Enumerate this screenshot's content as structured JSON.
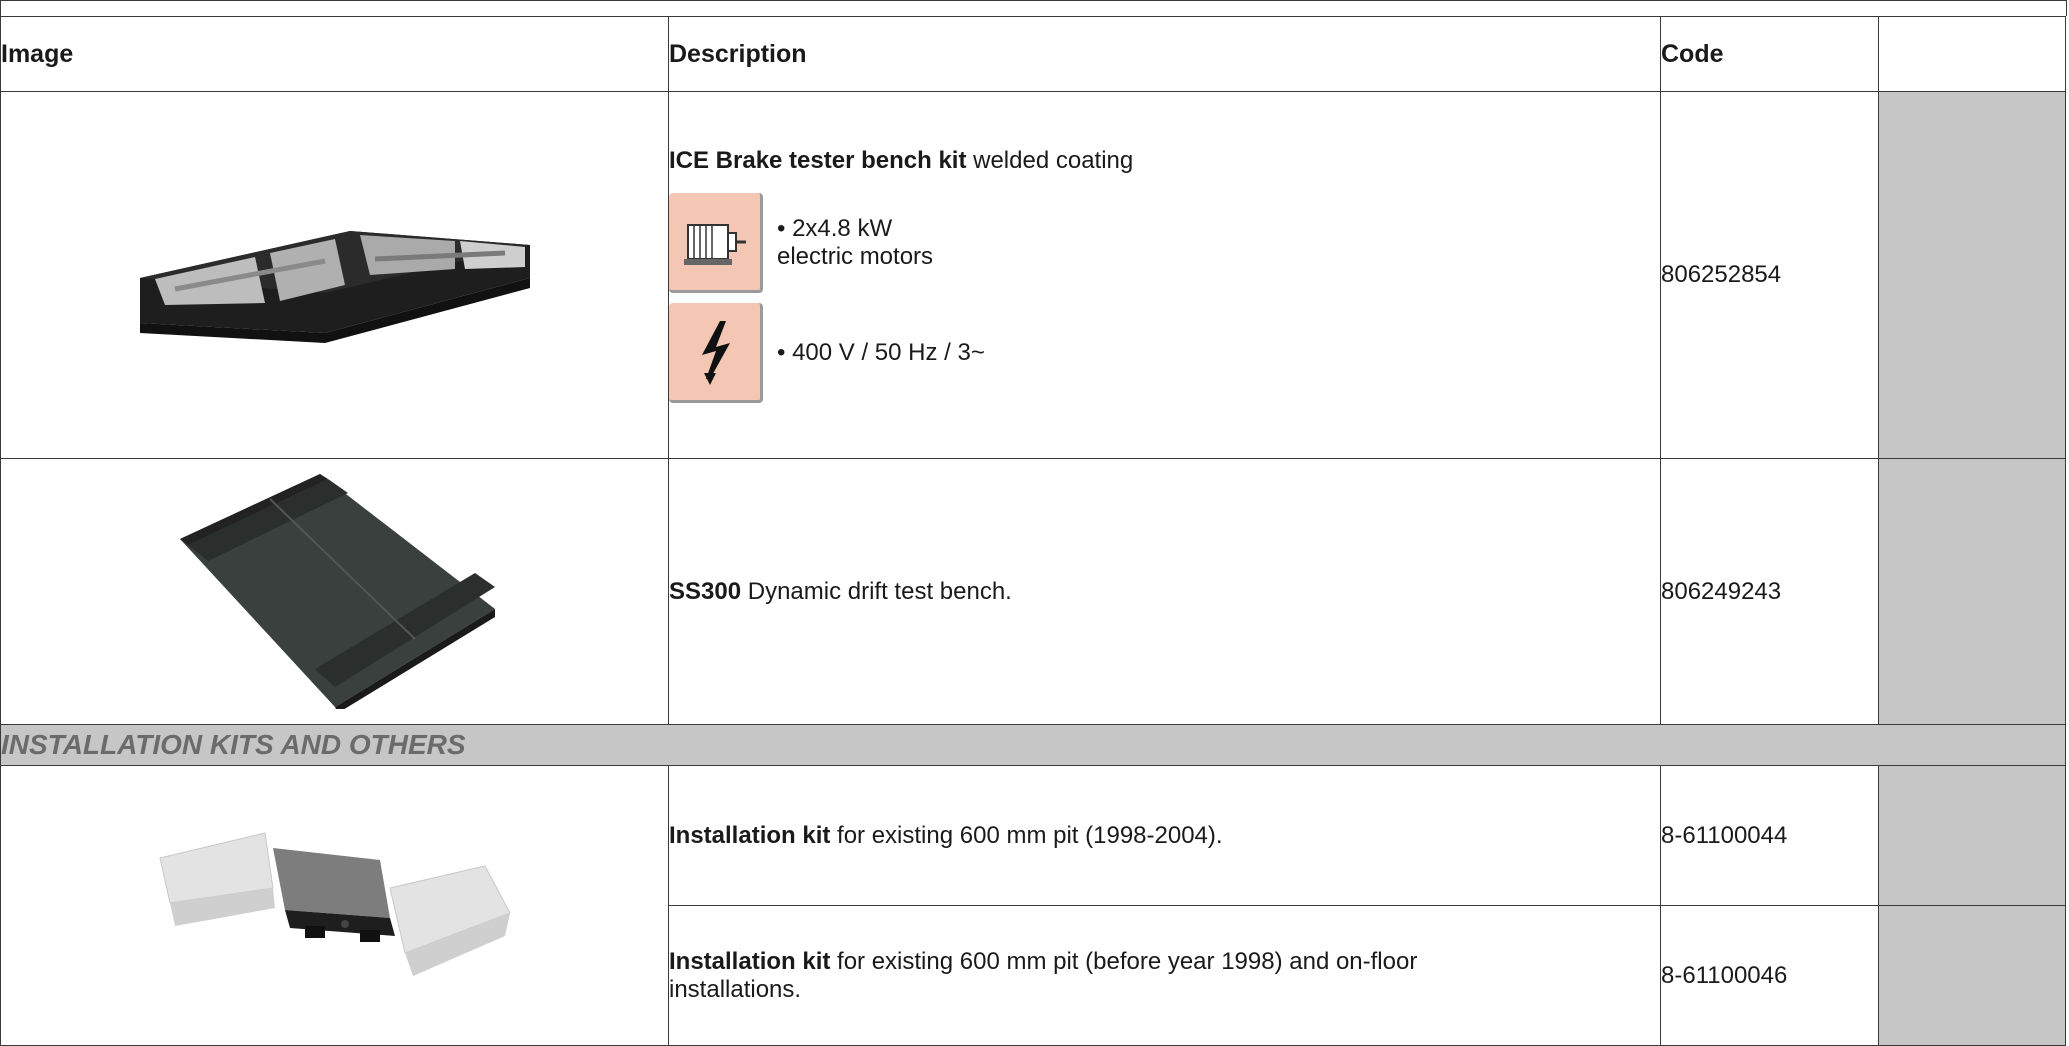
{
  "table": {
    "headers": {
      "image": "Image",
      "description": "Description",
      "code": "Code",
      "extra": ""
    },
    "rows": [
      {
        "image_icon": "brake-tester-bench-photo",
        "title_bold": "ICE Brake tester bench kit",
        "title_rest": " welded coating",
        "features": [
          {
            "icon": "electric-motor-icon",
            "bullet": "• 2x4.8 kW",
            "line2": "electric motors"
          },
          {
            "icon": "high-voltage-icon",
            "bullet": "• 400 V / 50 Hz / 3~",
            "line2": ""
          }
        ],
        "code": "806252854"
      },
      {
        "image_icon": "drift-test-plate-photo",
        "title_bold": "SS300",
        "title_rest": " Dynamic drift test bench.",
        "code": "806249243"
      }
    ],
    "section": "INSTALLATION KITS AND OTHERS",
    "install_rows": [
      {
        "title_bold": "Installation kit",
        "title_rest": " for existing 600 mm pit (1998-2004).",
        "code": "8-61100044"
      },
      {
        "title_bold": "Installation kit",
        "title_rest": " for existing 600 mm pit (before year 1998) and on-floor installations.",
        "code": "8-61100046"
      }
    ],
    "install_image_icon": "installation-kit-photo"
  },
  "colors": {
    "accent_gray": "#c6c6c6",
    "icon_bg": "#f4c7b4",
    "section_text": "#6b6b6b"
  }
}
